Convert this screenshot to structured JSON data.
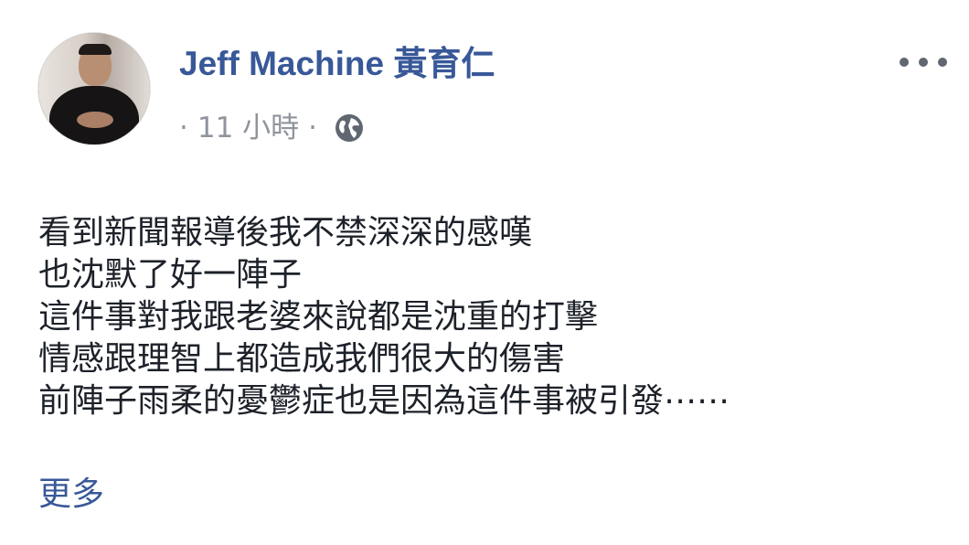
{
  "post": {
    "author": "Jeff Machine 黃育仁",
    "meta": {
      "leading_dot": "·",
      "time": "11 小時",
      "separator": "·",
      "privacy_icon": "globe-icon"
    },
    "menu_icon": "more-horizontal-icon",
    "message_lines": [
      "看到新聞報導後我不禁深深的感嘆",
      "也沈默了好一陣子",
      "這件事對我跟老婆來說都是沈重的打擊",
      "情感跟理智上都造成我們很大的傷害",
      "前陣子雨柔的憂鬱症也是因為這件事被引發⋯⋯"
    ],
    "see_more": "更多"
  },
  "colors": {
    "author_link": "#385898",
    "meta_text": "#90949c",
    "body_text": "#1d2129"
  }
}
